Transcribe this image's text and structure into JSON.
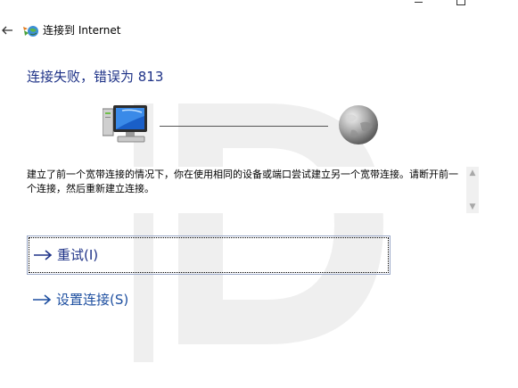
{
  "window": {
    "title": "连接到 Internet"
  },
  "main": {
    "title": "连接失败，错误为 813",
    "message": "建立了前一个宽带连接的情况下，你在使用相同的设备或端口尝试建立另一个宽带连接。请断开前一个连接，然后重新建立连接。"
  },
  "actions": [
    {
      "label": "重试(I)",
      "icon": "arrow-right-icon"
    },
    {
      "label": "设置连接(S)",
      "icon": "arrow-right-icon"
    }
  ],
  "colors": {
    "heading": "#1e3287",
    "link": "#1e4fa0",
    "focus_border": "#9aa8c8"
  }
}
